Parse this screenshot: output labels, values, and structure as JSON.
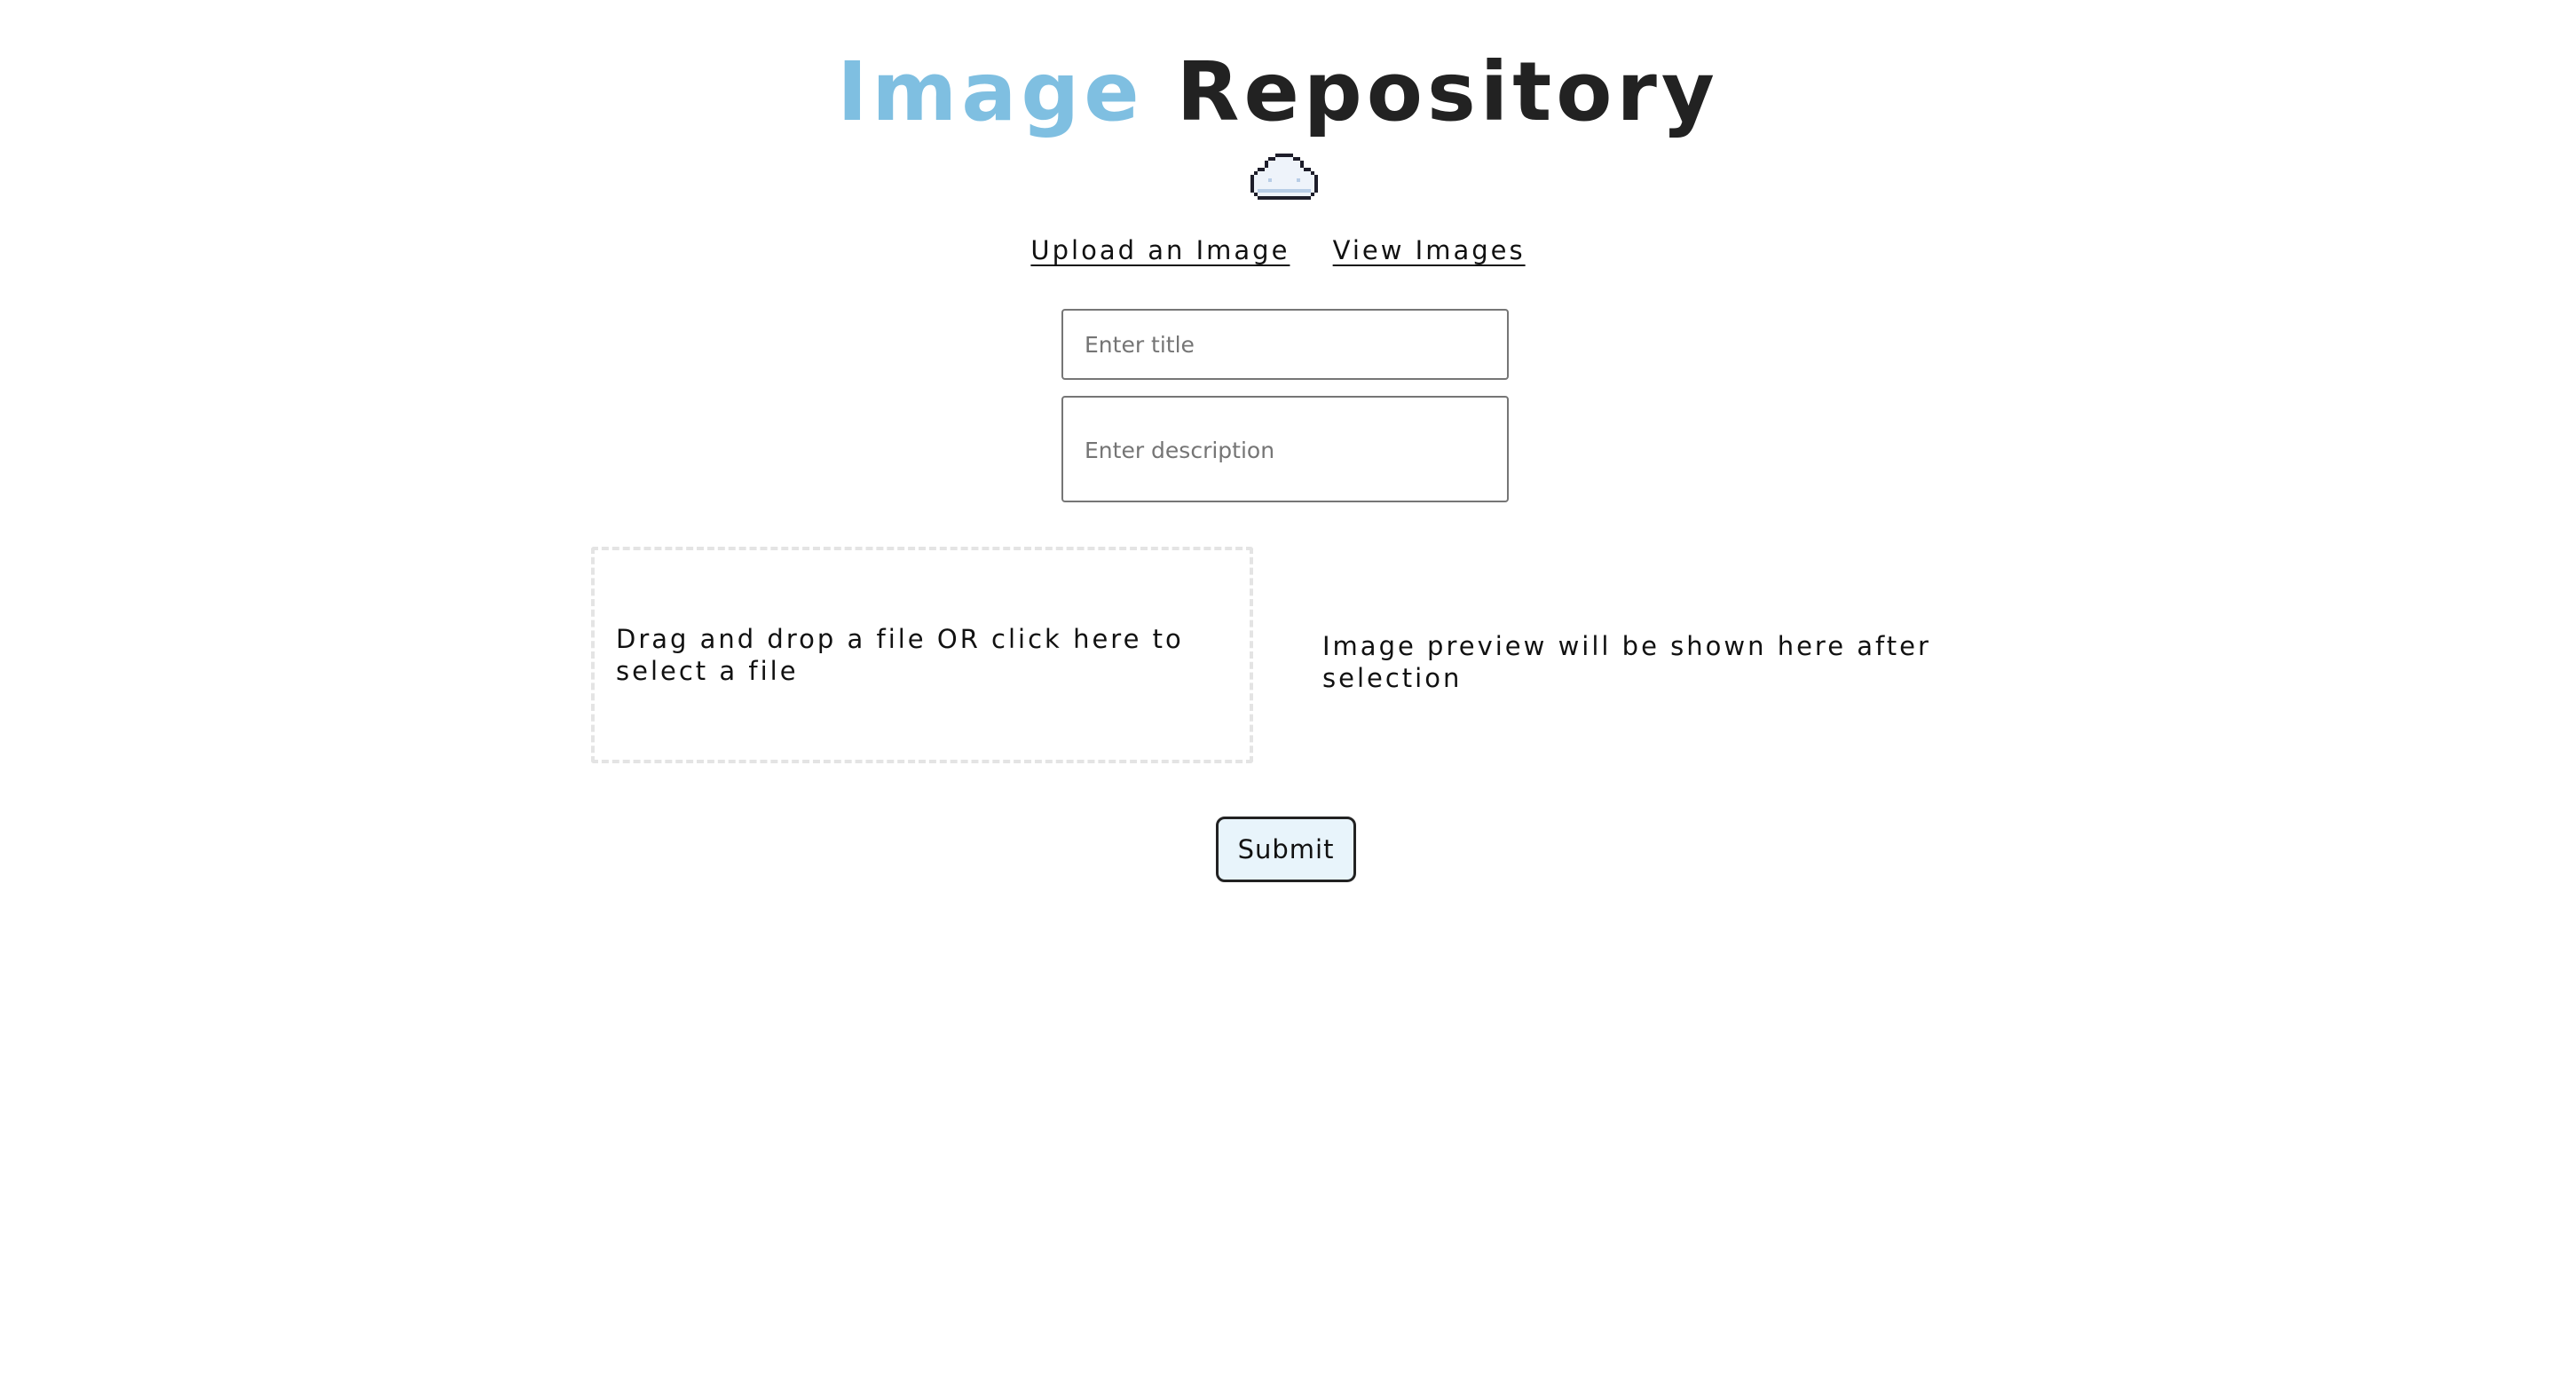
{
  "header": {
    "title_accent": "Image",
    "title_rest": "Repository",
    "logo_icon": "cloud-icon",
    "colors": {
      "accent": "#7fbfe1",
      "title_dark": "#222222"
    }
  },
  "nav": {
    "upload_label": "Upload an Image",
    "view_label": "View Images"
  },
  "form": {
    "title_placeholder": "Enter title",
    "title_value": "",
    "description_placeholder": "Enter description",
    "description_value": "",
    "dropzone_text": "Drag and drop a file OR click here to select a file",
    "preview_text": "Image preview will be shown here after selection",
    "submit_label": "Submit",
    "submit_bg": "#e8f4fb"
  }
}
